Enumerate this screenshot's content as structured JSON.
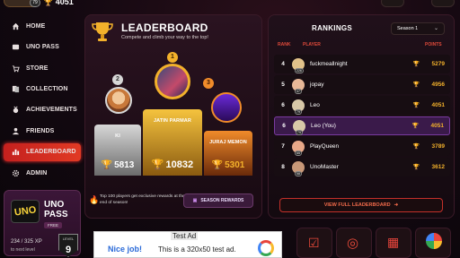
{
  "topbar": {
    "level": "79",
    "coins": "4051"
  },
  "sidebar": {
    "items": [
      {
        "label": "HOME",
        "icon": "home-icon"
      },
      {
        "label": "UNO PASS",
        "icon": "pass-icon"
      },
      {
        "label": "STORE",
        "icon": "cart-icon"
      },
      {
        "label": "COLLECTION",
        "icon": "collection-icon"
      },
      {
        "label": "ACHIEVEMENTS",
        "icon": "medal-icon"
      },
      {
        "label": "FRIENDS",
        "icon": "friends-icon"
      },
      {
        "label": "LEADERBOARD",
        "icon": "leaderboard-icon"
      },
      {
        "label": "ADMIN",
        "icon": "gear-icon"
      }
    ],
    "active": "LEADERBOARD"
  },
  "unopass": {
    "logo": "UNO",
    "title_line1": "UNO",
    "title_line2": "PASS",
    "badge": "FREE",
    "xp": "234 / 325 XP",
    "next": "to next level",
    "level_label": "LEVEL",
    "level": "9"
  },
  "leaderboard": {
    "title": "LEADERBOARD",
    "subtitle": "Compete and climb your way to the top!",
    "podium": [
      {
        "rank": "2",
        "name": "KI",
        "score": "5813"
      },
      {
        "rank": "1",
        "name": "JATIN PARMAR",
        "score": "10832"
      },
      {
        "rank": "3",
        "name": "JURAJ MEMON",
        "score": "5301"
      }
    ],
    "info_text": "Top 100 players get exclusive rewards at the end of season!",
    "season_rewards": "SEASON REWARDS"
  },
  "rankings": {
    "title": "RANKINGS",
    "season": "Season 1",
    "col_rank": "RANK",
    "col_player": "PLAYER",
    "col_points": "POINTS",
    "rows": [
      {
        "rank": "4",
        "level": "226",
        "name": "fuckmeallnight",
        "points": "5279"
      },
      {
        "rank": "5",
        "level": "47",
        "name": "jopay",
        "points": "4956"
      },
      {
        "rank": "6",
        "level": "79",
        "name": "Leo",
        "points": "4051"
      },
      {
        "rank": "6",
        "level": "79",
        "name": "Leo (You)",
        "points": "4051"
      },
      {
        "rank": "7",
        "level": "65",
        "name": "PlayQueen",
        "points": "3789"
      },
      {
        "rank": "8",
        "level": "58",
        "name": "UnoMaster",
        "points": "3612"
      }
    ],
    "view_full": "VIEW FULL LEADERBOARD"
  },
  "ad": {
    "label": "Test Ad",
    "nice": "Nice job!",
    "text": "This is a 320x50 test ad."
  },
  "colors": {
    "accent": "#e13a24",
    "gold": "#f3b12b",
    "me_row": "#3a1a4a"
  }
}
